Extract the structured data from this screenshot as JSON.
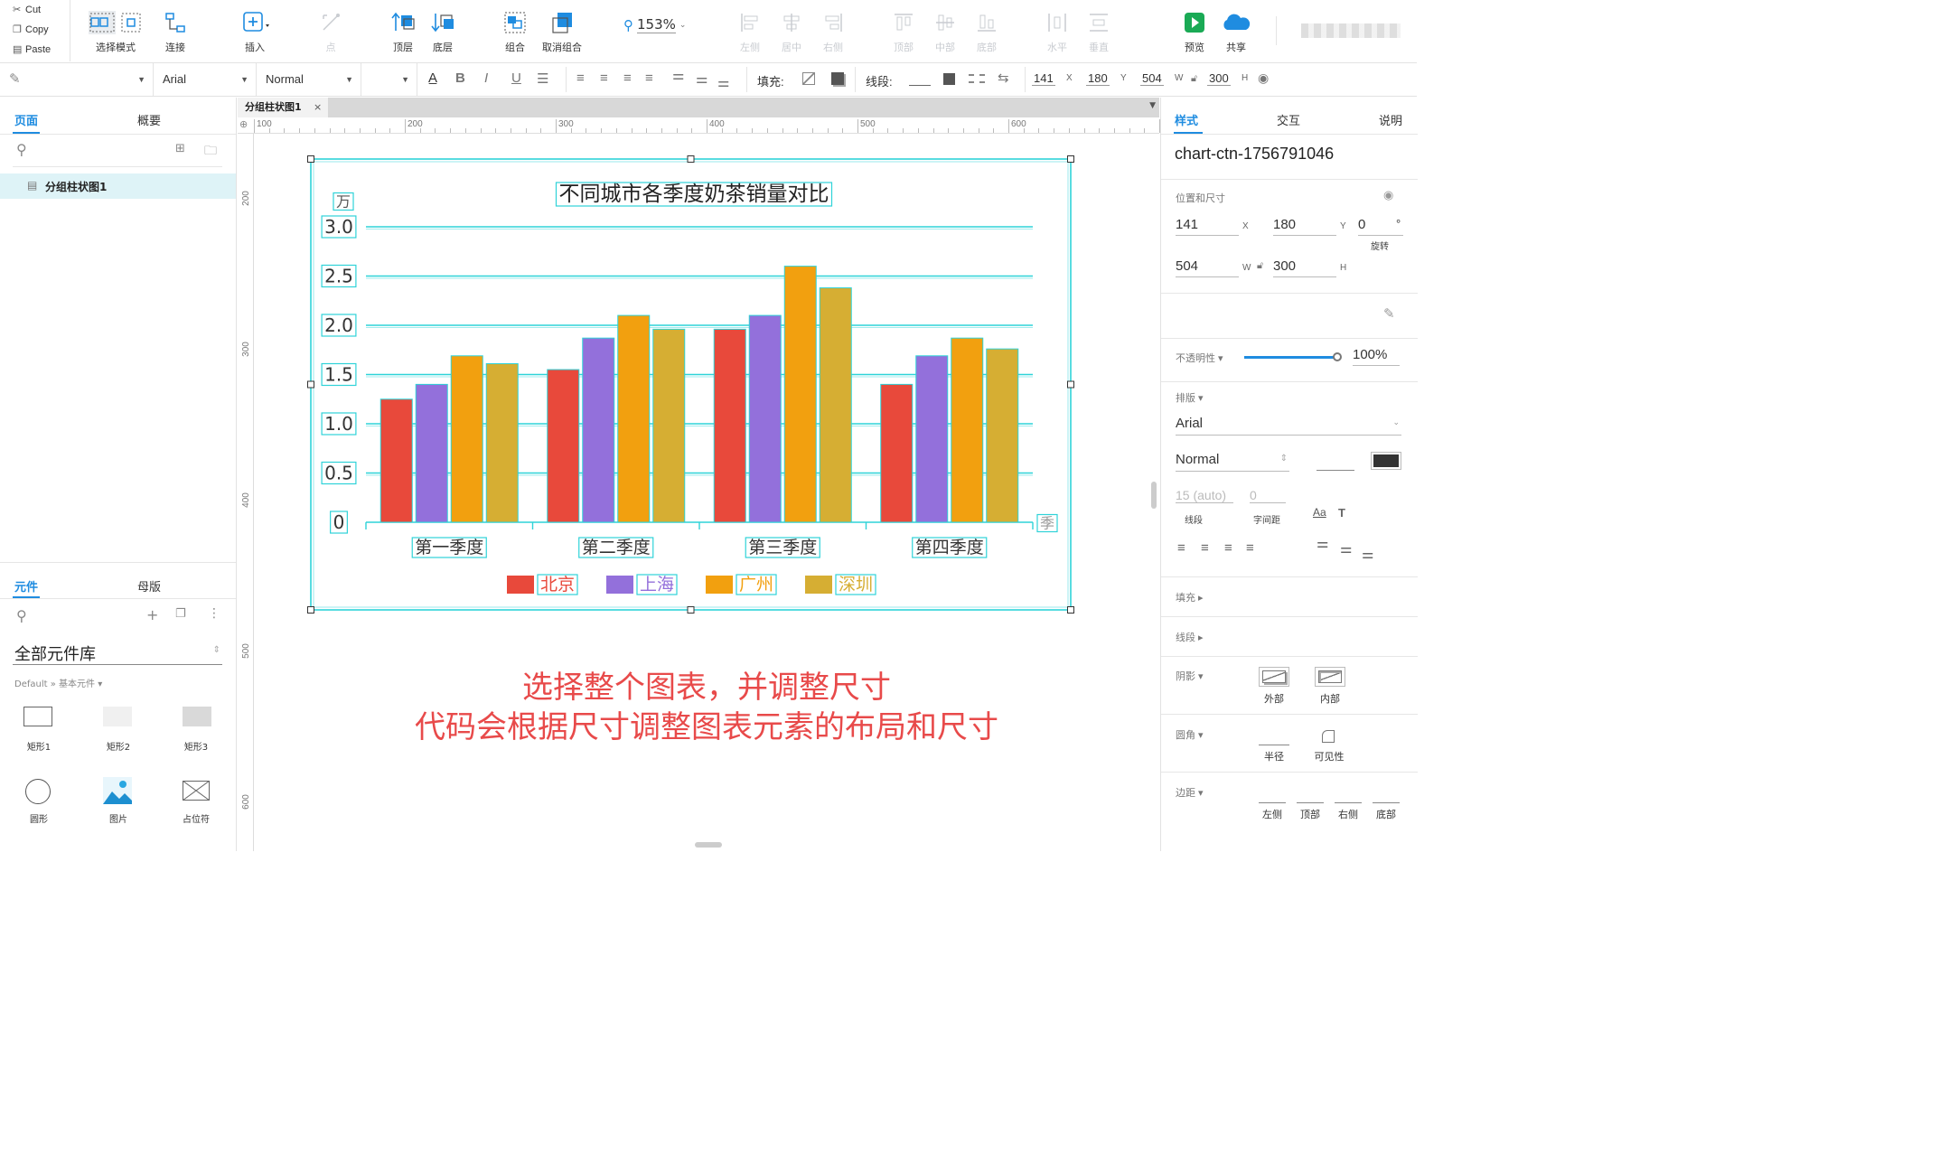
{
  "clipboard": {
    "cut": "Cut",
    "copy": "Copy",
    "paste": "Paste"
  },
  "toolbar": {
    "select_mode": "选择模式",
    "connect": "连接",
    "insert": "插入",
    "point": "点",
    "front": "顶层",
    "back": "底层",
    "group": "组合",
    "ungroup": "取消组合",
    "zoom": "153%",
    "align_left": "左侧",
    "align_center": "居中",
    "align_right": "右侧",
    "align_top": "顶部",
    "align_middle": "中部",
    "align_bottom": "底部",
    "dist_h": "水平",
    "dist_v": "垂直",
    "preview": "预览",
    "share": "共享"
  },
  "format": {
    "font": "Arial",
    "weight": "Normal",
    "fill_label": "填充:",
    "stroke_label": "线段:",
    "x": "141",
    "y": "180",
    "w": "504",
    "h": "300",
    "x_unit": "X",
    "y_unit": "Y",
    "w_unit": "W",
    "h_unit": "H"
  },
  "left": {
    "tab_pages": "页面",
    "tab_outline": "概要",
    "page_item": "分组柱状图1",
    "tab_widgets": "元件",
    "tab_masters": "母版",
    "library": "全部元件库",
    "library_path": "Default » 基本元件 ▾",
    "widgets": [
      {
        "label": "矩形1"
      },
      {
        "label": "矩形2"
      },
      {
        "label": "矩形3"
      },
      {
        "label": "圆形"
      },
      {
        "label": "图片"
      },
      {
        "label": "占位符"
      }
    ]
  },
  "canvas": {
    "doc_tab": "分组柱状图1",
    "ruler_top": [
      "100",
      "200",
      "300",
      "400",
      "500",
      "600"
    ],
    "ruler_left": [
      "200",
      "300",
      "400",
      "500",
      "600"
    ],
    "element_name": "chart-ctn-1756791046",
    "note_line1": "选择整个图表，并调整尺寸",
    "note_line2": "代码会根据尺寸调整图表元素的布局和尺寸"
  },
  "right": {
    "tab_style": "样式",
    "tab_interact": "交互",
    "tab_notes": "说明",
    "element_name": "chart-ctn-1756791046",
    "pos_size_label": "位置和尺寸",
    "x": "141",
    "y": "180",
    "rotation": "0",
    "rotation_unit": "°",
    "rotation_label": "旋转",
    "w": "504",
    "h": "300",
    "opacity_label": "不透明性 ▾",
    "opacity": "100%",
    "opacity_value": 1.0,
    "typography_label": "排版 ▾",
    "font": "Arial",
    "weight": "Normal",
    "line_height": "15 (auto)",
    "line_height_label": "线段",
    "letter_spacing": "0",
    "letter_spacing_label": "字间距",
    "fill_label": "填充 ▸",
    "stroke_label": "线段 ▸",
    "shadow_label": "阴影 ▾",
    "shadow_outer": "外部",
    "shadow_inner": "内部",
    "corner_label": "圆角 ▾",
    "corner_radius": "半径",
    "corner_visibility": "可见性",
    "padding_label": "边距 ▾",
    "padding_left": "左侧",
    "padding_top": "顶部",
    "padding_right": "右侧",
    "padding_bottom": "底部"
  },
  "colors": {
    "accent": "#1f8ce0",
    "guide": "#2fd3d8",
    "note": "#e84a4a"
  },
  "chart_data": {
    "type": "bar",
    "title": "不同城市各季度奶茶销量对比",
    "ylabel": "万",
    "xlabel": "季",
    "categories": [
      "第一季度",
      "第二季度",
      "第三季度",
      "第四季度"
    ],
    "yticks": [
      "0",
      "0.5",
      "1.0",
      "1.5",
      "2.0",
      "2.5",
      "3.0"
    ],
    "ylim": [
      0,
      3.0
    ],
    "grid": true,
    "legend": "bottom",
    "series": [
      {
        "name": "北京",
        "color": "#e8493b",
        "values": [
          1.25,
          1.55,
          1.96,
          1.4
        ]
      },
      {
        "name": "上海",
        "color": "#9370db",
        "values": [
          1.4,
          1.87,
          2.1,
          1.69
        ]
      },
      {
        "name": "广州",
        "color": "#f2a00f",
        "values": [
          1.69,
          2.1,
          2.6,
          1.87
        ]
      },
      {
        "name": "深圳",
        "color": "#d6ae33",
        "values": [
          1.61,
          1.96,
          2.38,
          1.76
        ]
      }
    ]
  }
}
